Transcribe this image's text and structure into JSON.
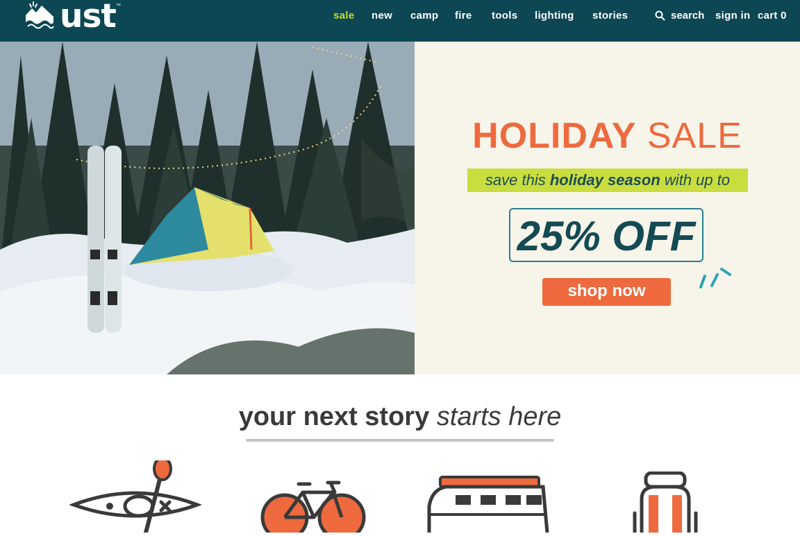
{
  "brand": {
    "name": "ust",
    "trademark": "™",
    "logo_icon": "mountain-wave-icon"
  },
  "nav": {
    "items": [
      "sale",
      "new",
      "camp",
      "fire",
      "tools",
      "lighting",
      "stories"
    ],
    "search_label": "search",
    "search_icon": "search-icon",
    "signin_label": "sign in",
    "cart_label": "cart 0"
  },
  "hero": {
    "image_alt_icon": "snow-camp-photo",
    "title_bold": "HOLIDAY",
    "title_light": "SALE",
    "save_prefix": "save this",
    "save_bold": "holiday season",
    "save_suffix": "with up to",
    "discount": "25% OFF",
    "cta_label": "shop now"
  },
  "story": {
    "title_bold": "your next story",
    "title_italic": "starts here",
    "categories": [
      "kayak-icon",
      "bicycle-icon",
      "van-icon",
      "backpack-icon"
    ]
  },
  "colors": {
    "header_bg": "#0c4753",
    "accent_orange": "#ee6a3e",
    "accent_lime": "#c9dd3f",
    "teal_text": "#134a54",
    "promo_bg": "#f7f4ea"
  }
}
